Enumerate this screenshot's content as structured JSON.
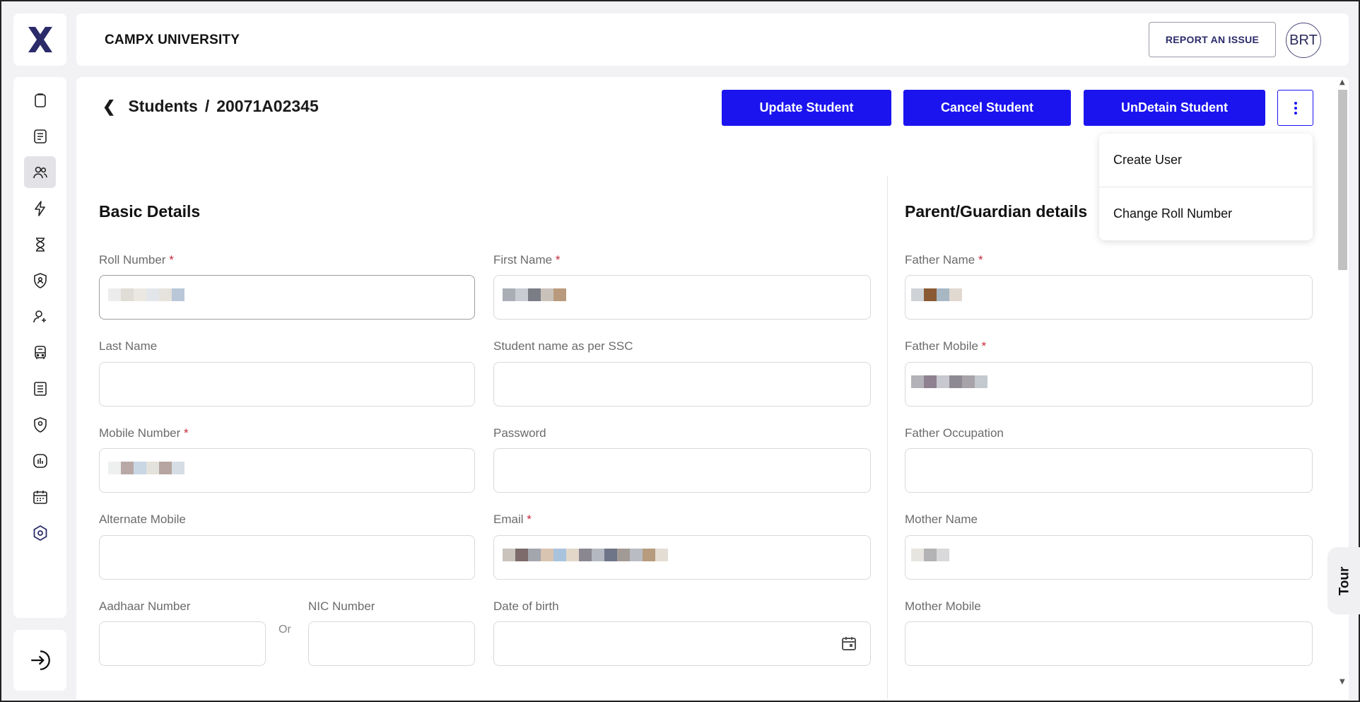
{
  "app": {
    "brand": "CAMPX UNIVERSITY",
    "report_label": "REPORT AN ISSUE",
    "avatar_initials": "BRT"
  },
  "sidebar": {
    "icons": [
      "clipboard-icon",
      "document-icon",
      "users-icon",
      "bolt-icon",
      "hourglass-icon",
      "shield-user-icon",
      "user-add-icon",
      "bus-icon",
      "report-icon",
      "shield-pin-icon",
      "chart-icon",
      "calendar-icon",
      "settings-icon"
    ],
    "active_index": 2,
    "logout_icon": "logout-icon"
  },
  "breadcrumb": {
    "section": "Students",
    "separator": "/",
    "record": "20071A02345"
  },
  "actions": {
    "update": "Update Student",
    "cancel": "Cancel Student",
    "undetain": "UnDetain Student"
  },
  "menu": {
    "items": [
      "Create User",
      "Change Roll Number"
    ]
  },
  "basic": {
    "title": "Basic Details",
    "roll_number": "Roll Number",
    "first_name": "First Name",
    "last_name": "Last Name",
    "ssc_name": "Student name as per SSC",
    "mobile": "Mobile Number",
    "password": "Password",
    "alt_mobile": "Alternate Mobile",
    "email": "Email",
    "aadhaar": "Aadhaar Number",
    "or": "Or",
    "nic": "NIC Number",
    "dob": "Date of birth"
  },
  "parent": {
    "title": "Parent/Guardian details",
    "father_name": "Father Name",
    "father_mobile": "Father Mobile",
    "father_occupation": "Father Occupation",
    "mother_name": "Mother Name",
    "mother_mobile": "Mother Mobile"
  },
  "required_mark": "*",
  "tour": "Tour",
  "colors": {
    "primary": "#1b14ef",
    "required": "#c6283a",
    "accent": "#2b2b6a"
  }
}
